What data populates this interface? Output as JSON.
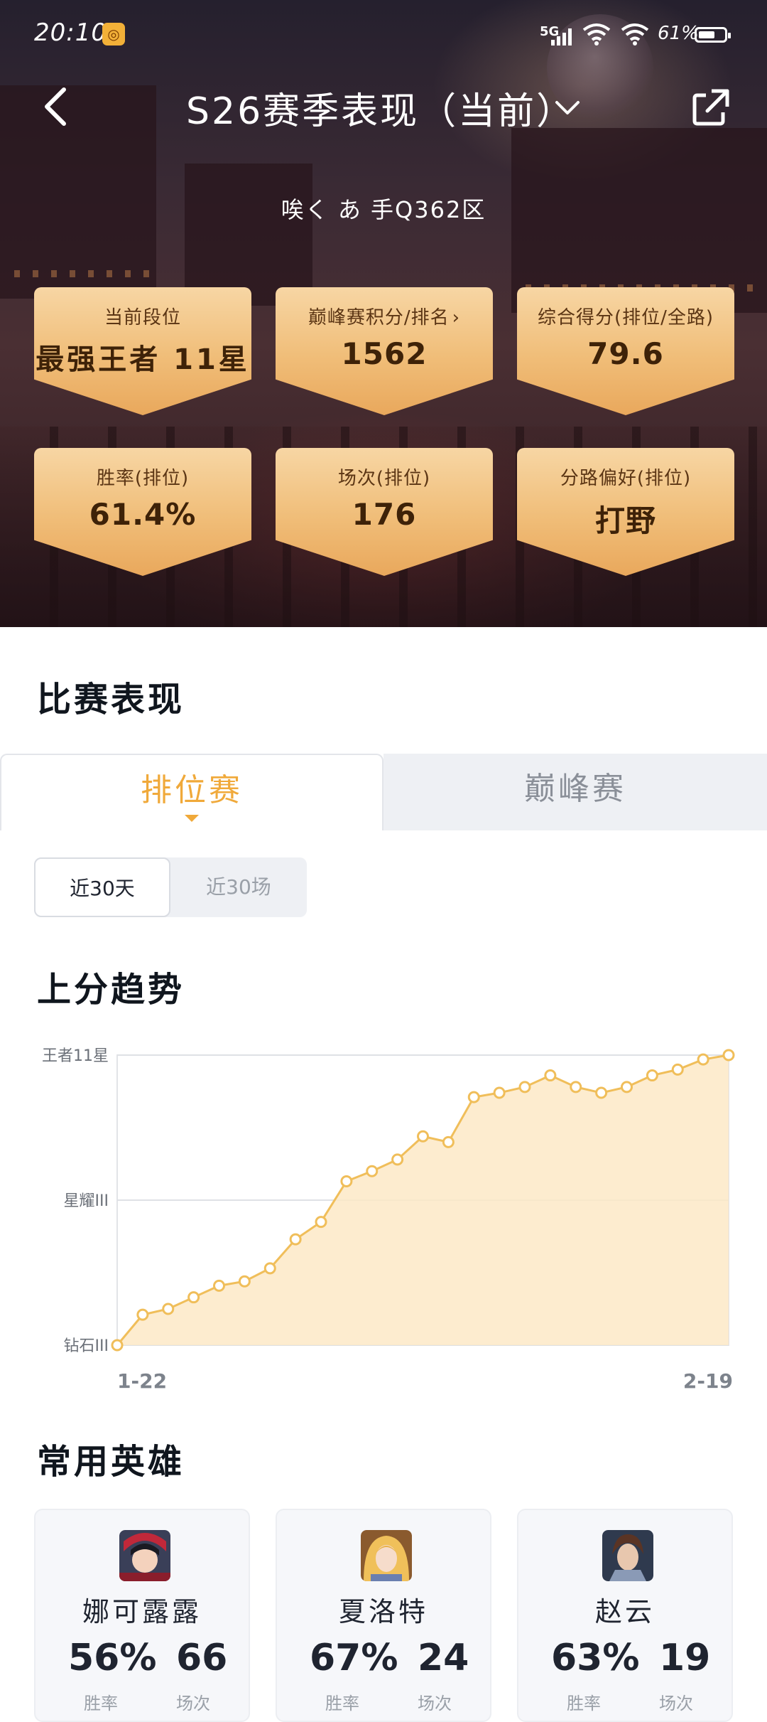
{
  "status": {
    "time": "20:10",
    "network": "5G",
    "battery": "61%"
  },
  "header": {
    "title": "S26赛季表现（当前）"
  },
  "player": {
    "name_server": "唉く あ  手Q362区"
  },
  "stats": [
    {
      "label": "当前段位",
      "value": "最强王者 11星"
    },
    {
      "label": "巅峰赛积分/排名",
      "value": "1562",
      "has_arrow": true
    },
    {
      "label": "综合得分(排位/全路)",
      "value": "79.6"
    },
    {
      "label": "胜率(排位)",
      "value": "61.4%"
    },
    {
      "label": "场次(排位)",
      "value": "176"
    },
    {
      "label": "分路偏好(排位)",
      "value": "打野"
    }
  ],
  "performance": {
    "title": "比赛表现",
    "tabs": [
      "排位赛",
      "巅峰赛"
    ],
    "active_tab": 0,
    "filters": [
      "近30天",
      "近30场"
    ],
    "active_filter": 0
  },
  "trend": {
    "title": "上分趋势"
  },
  "chart_data": {
    "type": "area",
    "y_tick_labels": [
      "钻石III",
      "星耀III",
      "王者11星"
    ],
    "x_tick_labels": [
      "1-22",
      "2-19"
    ],
    "ylim": [
      0,
      2
    ],
    "values": [
      0.0,
      0.21,
      0.25,
      0.33,
      0.41,
      0.44,
      0.53,
      0.73,
      0.85,
      1.13,
      1.2,
      1.28,
      1.44,
      1.4,
      1.71,
      1.74,
      1.78,
      1.86,
      1.78,
      1.74,
      1.78,
      1.86,
      1.9,
      1.97,
      2.0
    ],
    "color": "#f0be5a"
  },
  "heroes_section": {
    "title": "常用英雄",
    "heroes": [
      {
        "name": "娜可露露",
        "win_rate": "56%",
        "games": "66",
        "rate_label": "胜率",
        "games_label": "场次"
      },
      {
        "name": "夏洛特",
        "win_rate": "67%",
        "games": "24",
        "rate_label": "胜率",
        "games_label": "场次"
      },
      {
        "name": "赵云",
        "win_rate": "63%",
        "games": "19",
        "rate_label": "胜率",
        "games_label": "场次"
      }
    ]
  }
}
